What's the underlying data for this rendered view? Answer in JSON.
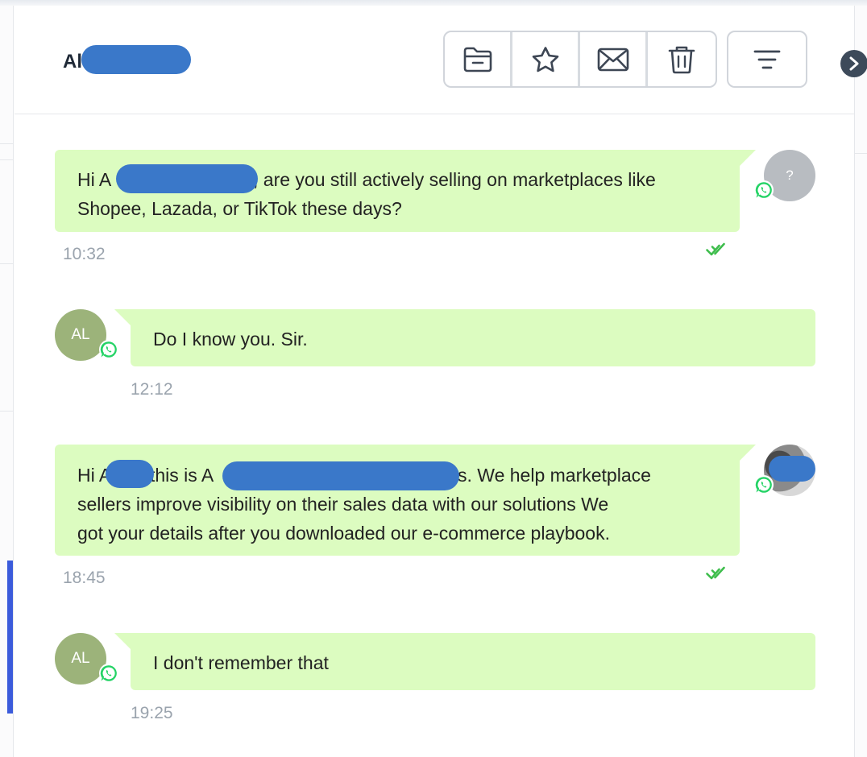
{
  "header": {
    "contact_name": "Al",
    "toolbar": {
      "archive": "folder-minus-icon",
      "star": "star-icon",
      "email": "envelope-icon",
      "delete": "trash-icon",
      "filter": "filter-lines-icon",
      "next": "chevron-right-icon"
    }
  },
  "messages": [
    {
      "direction": "outgoing",
      "parts": [
        "Hi A",
        ", are you still actively selling on marketplaces like",
        "Shopee, Lazada, or TikTok these days?"
      ],
      "time": "10:32",
      "status": "read",
      "avatar": "?"
    },
    {
      "direction": "incoming",
      "text": "Do I know you. Sir.",
      "time": "12:12",
      "avatar": "AL"
    },
    {
      "direction": "outgoing",
      "parts": [
        "Hi A",
        " this is A",
        "s. We help marketplace",
        "sellers improve visibility on their sales data with our solutions We",
        "got your details after you downloaded our e-commerce playbook."
      ],
      "time": "18:45",
      "status": "read"
    },
    {
      "direction": "incoming",
      "text": "I don't remember that",
      "time": "19:25",
      "avatar": "AL"
    }
  ],
  "colors": {
    "bubble": "#dcfcc0",
    "redaction": "#3a78c9",
    "read_check": "#3ebd4c",
    "whatsapp": "#25d366",
    "avatar_initials_bg": "#9cb37a",
    "avatar_unknown_bg": "#b8bcc1",
    "active_indicator": "#3b5bdb"
  }
}
